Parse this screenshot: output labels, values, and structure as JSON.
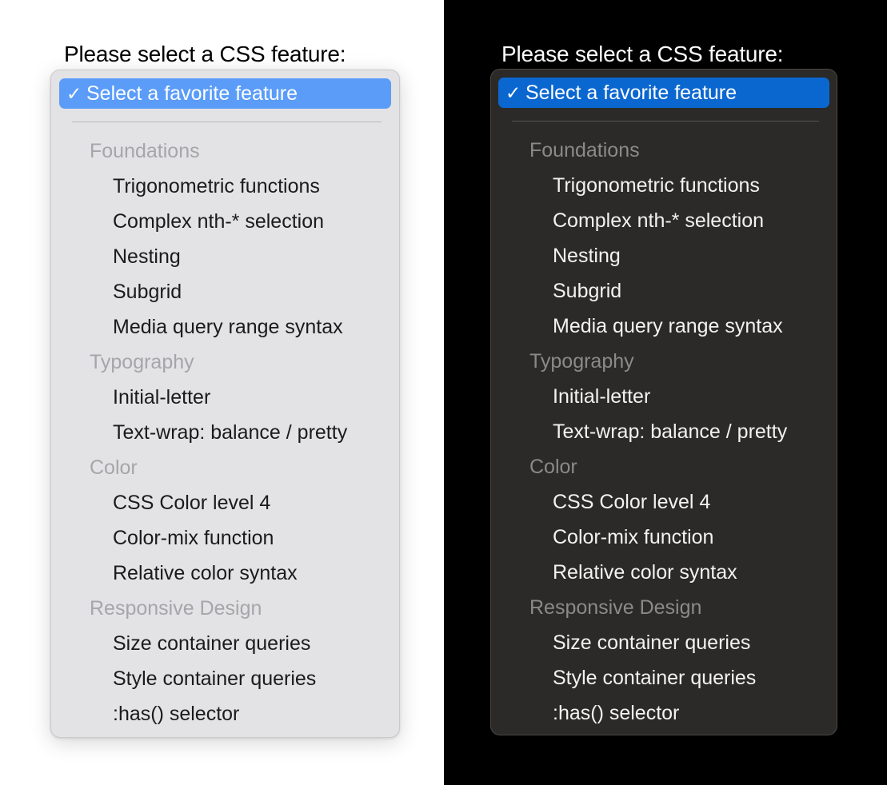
{
  "panels": [
    {
      "theme": "light",
      "prompt": "Please select a CSS feature:",
      "selected_option": "Select a favorite feature",
      "check_icon": "✓",
      "accent": "#5a9cf8",
      "panel_bg": "#e3e3e5",
      "text_color": "#1b1b1d",
      "group_color": "#a6a6aa",
      "page_bg": "#ffffff"
    },
    {
      "theme": "dark",
      "prompt": "Please select a CSS feature:",
      "selected_option": "Select a favorite feature",
      "check_icon": "✓",
      "accent": "#0b67d0",
      "panel_bg": "#2b2a28",
      "text_color": "#f2f2f0",
      "group_color": "#8a8a86",
      "page_bg": "#000000"
    }
  ],
  "groups": [
    {
      "label": "Foundations",
      "options": [
        "Trigonometric functions",
        "Complex nth-* selection",
        "Nesting",
        "Subgrid",
        "Media query range syntax"
      ]
    },
    {
      "label": "Typography",
      "options": [
        "Initial-letter",
        "Text-wrap: balance / pretty"
      ]
    },
    {
      "label": "Color",
      "options": [
        "CSS Color level 4",
        "Color-mix function",
        "Relative color syntax"
      ]
    },
    {
      "label": "Responsive Design",
      "options": [
        "Size container queries",
        "Style container queries",
        ":has() selector"
      ]
    }
  ]
}
